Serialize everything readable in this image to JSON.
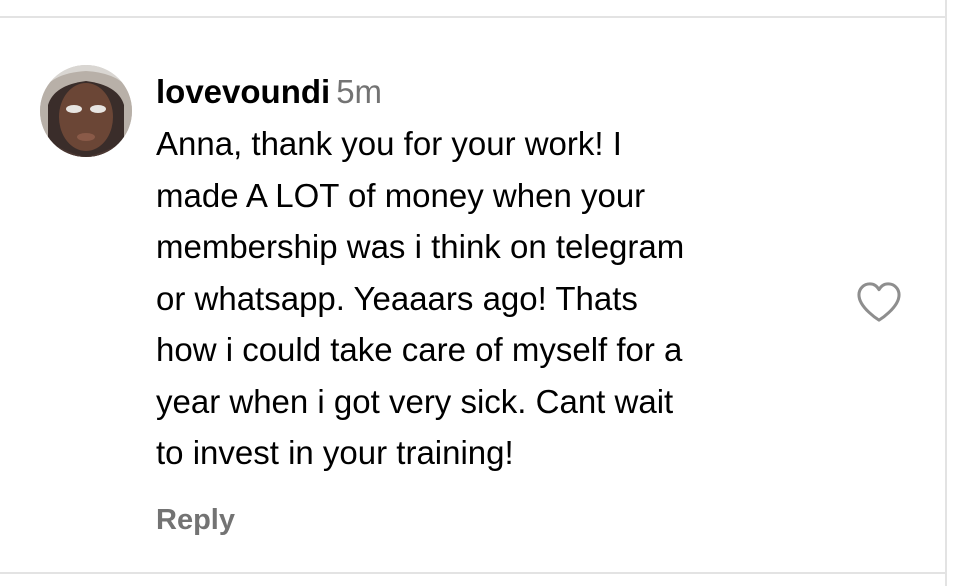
{
  "comment": {
    "username": "lovevoundi",
    "time_ago": "5m",
    "text_lines": [
      "Anna, thank you for your work! I",
      "made A LOT of money when your",
      "membership was i think on telegram",
      "or whatsapp. Yeaaars ago! Thats",
      "how i could take care of myself for a",
      "year when i got very sick. Cant wait",
      "to invest in your training!"
    ],
    "reply_label": "Reply",
    "like_icon": "heart-outline-icon"
  },
  "colors": {
    "text": "#000000",
    "secondary_text": "#737373",
    "divider": "#e3e3e3",
    "like_icon": "#8e8e8e"
  }
}
